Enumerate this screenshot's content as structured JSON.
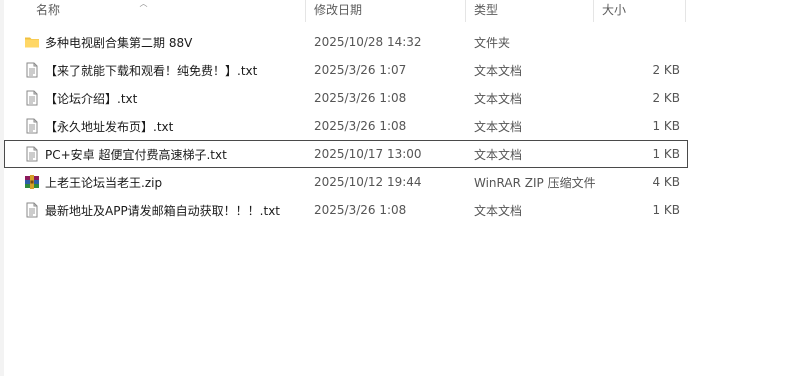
{
  "columns": {
    "name": "名称",
    "date": "修改日期",
    "type": "类型",
    "size": "大小"
  },
  "files": [
    {
      "name": "多种电视剧合集第二期 88V",
      "date": "2025/10/28 14:32",
      "type": "文件夹",
      "size": "",
      "icon": "folder-icon"
    },
    {
      "name": "【来了就能下载和观看！纯免费！】.txt",
      "date": "2025/3/26 1:07",
      "type": "文本文档",
      "size": "2 KB",
      "icon": "text-file-icon"
    },
    {
      "name": "【论坛介绍】.txt",
      "date": "2025/3/26 1:08",
      "type": "文本文档",
      "size": "2 KB",
      "icon": "text-file-icon"
    },
    {
      "name": "【永久地址发布页】.txt",
      "date": "2025/3/26 1:08",
      "type": "文本文档",
      "size": "1 KB",
      "icon": "text-file-icon"
    },
    {
      "name": "PC+安卓 超便宜付费高速梯子.txt",
      "date": "2025/10/17 13:00",
      "type": "文本文档",
      "size": "1 KB",
      "icon": "text-file-icon",
      "focused": true
    },
    {
      "name": "上老王论坛当老王.zip",
      "date": "2025/10/12 19:44",
      "type": "WinRAR ZIP 压缩文件",
      "size": "4 KB",
      "icon": "winrar-archive-icon"
    },
    {
      "name": "最新地址及APP请发邮箱自动获取！！！.txt",
      "date": "2025/3/26 1:08",
      "type": "文本文档",
      "size": "1 KB",
      "icon": "text-file-icon"
    }
  ]
}
